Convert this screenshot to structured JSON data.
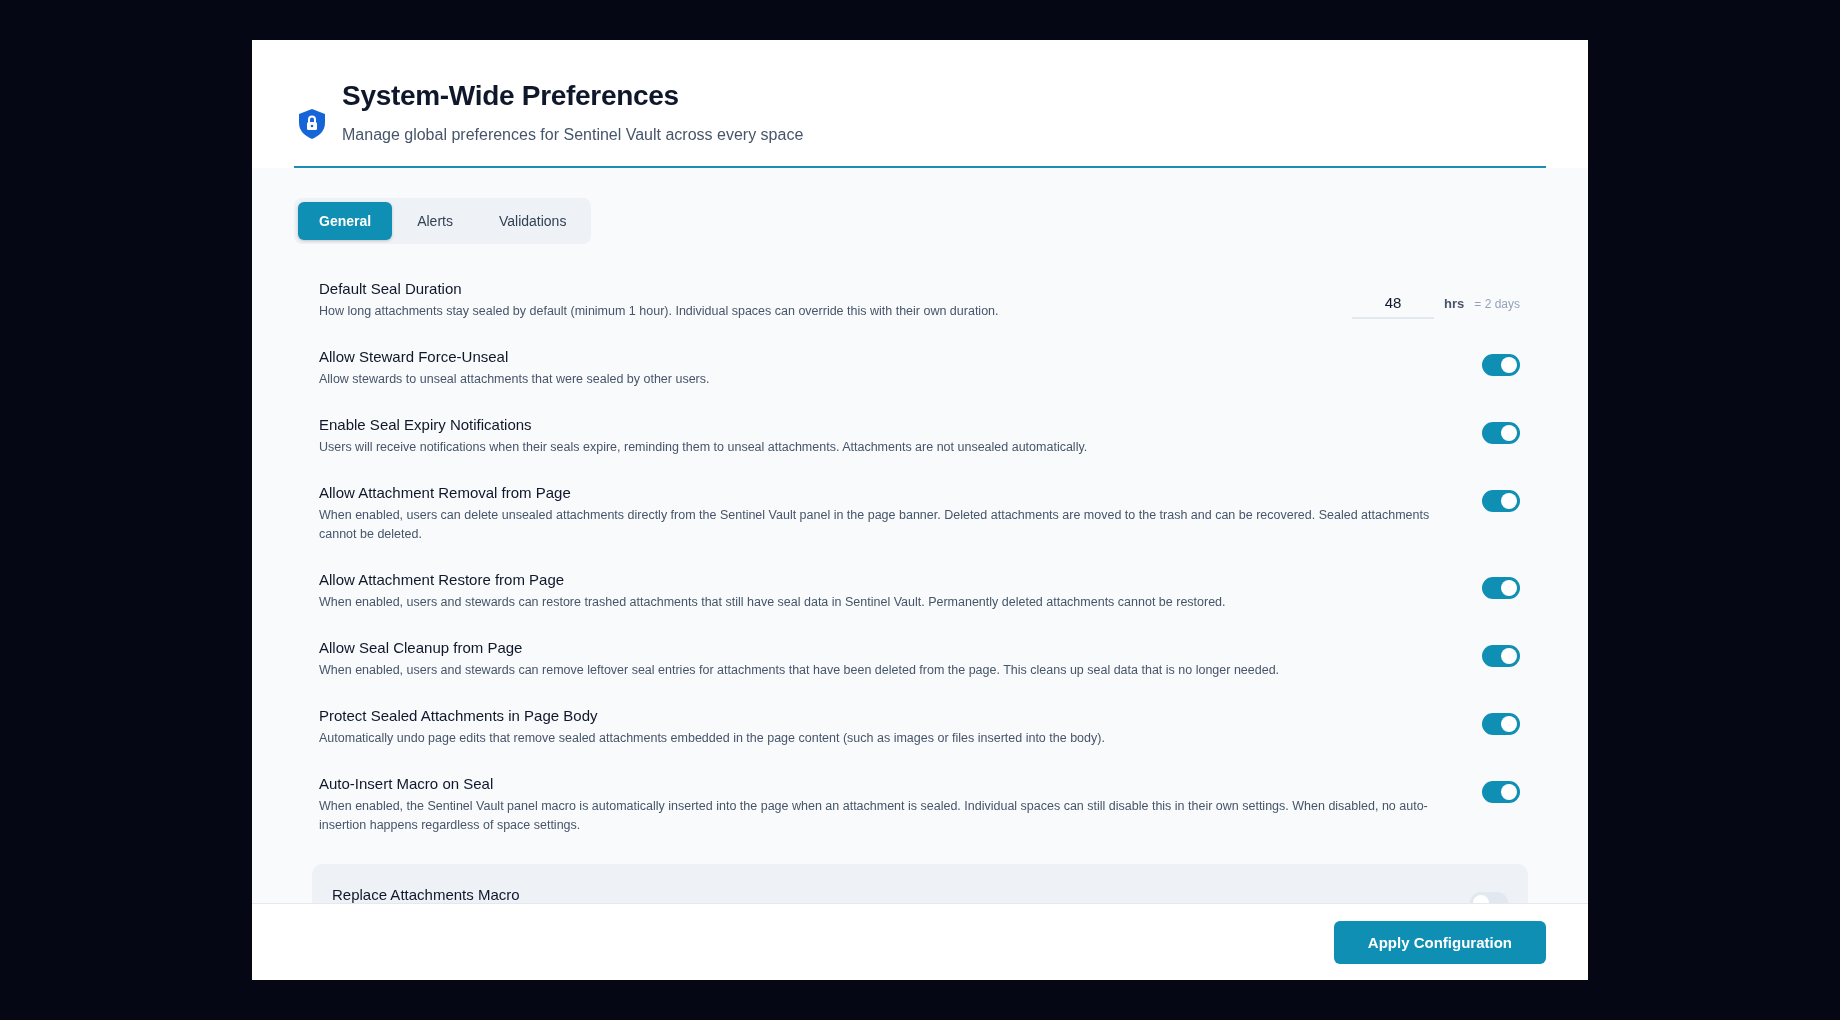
{
  "header": {
    "title": "System-Wide Preferences",
    "subtitle": "Manage global preferences for Sentinel Vault across every space"
  },
  "tabs": [
    {
      "label": "General",
      "selected": true
    },
    {
      "label": "Alerts",
      "selected": false
    },
    {
      "label": "Validations",
      "selected": false
    }
  ],
  "settings": [
    {
      "kind": "number",
      "title": "Default Seal Duration",
      "description": "How long attachments stay sealed by default (minimum 1 hour). Individual spaces can override this with their own duration.",
      "value": "48",
      "unit": "hrs",
      "hint": "= 2 days"
    },
    {
      "kind": "toggle",
      "title": "Allow Steward Force-Unseal",
      "description": "Allow stewards to unseal attachments that were sealed by other users.",
      "on": true
    },
    {
      "kind": "toggle",
      "title": "Enable Seal Expiry Notifications",
      "description": "Users will receive notifications when their seals expire, reminding them to unseal attachments. Attachments are not unsealed automatically.",
      "on": true
    },
    {
      "kind": "toggle",
      "title": "Allow Attachment Removal from Page",
      "description": "When enabled, users can delete unsealed attachments directly from the Sentinel Vault panel in the page banner. Deleted attachments are moved to the trash and can be recovered. Sealed attachments cannot be deleted.",
      "on": true
    },
    {
      "kind": "toggle",
      "title": "Allow Attachment Restore from Page",
      "description": "When enabled, users and stewards can restore trashed attachments that still have seal data in Sentinel Vault. Permanently deleted attachments cannot be restored.",
      "on": true
    },
    {
      "kind": "toggle",
      "title": "Allow Seal Cleanup from Page",
      "description": "When enabled, users and stewards can remove leftover seal entries for attachments that have been deleted from the page. This cleans up seal data that is no longer needed.",
      "on": true
    },
    {
      "kind": "toggle",
      "title": "Protect Sealed Attachments in Page Body",
      "description": "Automatically undo page edits that remove sealed attachments embedded in the page content (such as images or files inserted into the body).",
      "on": true
    },
    {
      "kind": "toggle",
      "title": "Auto-Insert Macro on Seal",
      "description": "When enabled, the Sentinel Vault panel macro is automatically inserted into the page when an attachment is sealed. Individual spaces can still disable this in their own settings. When disabled, no auto-insertion happens regardless of space settings.",
      "on": true
    },
    {
      "kind": "toggle",
      "title": "Replace Attachments Macro",
      "on": false,
      "highlighted": true
    }
  ],
  "footer": {
    "button": "Apply Configuration"
  }
}
